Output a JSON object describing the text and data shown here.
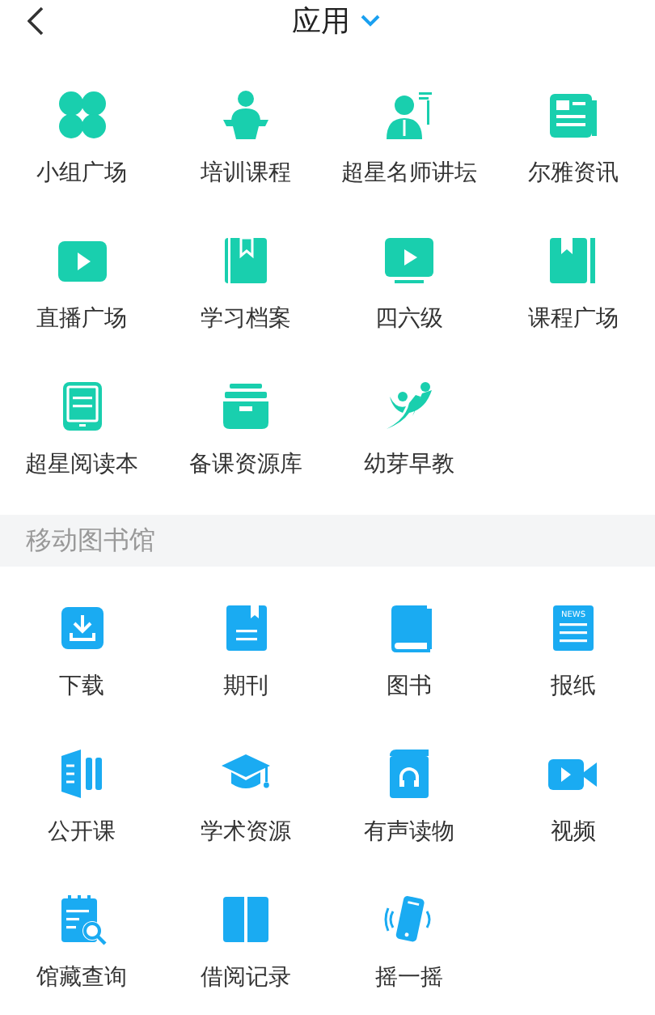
{
  "header": {
    "title": "应用"
  },
  "sections": [
    {
      "items": [
        {
          "label": "小组广场"
        },
        {
          "label": "培训课程"
        },
        {
          "label": "超星名师讲坛"
        },
        {
          "label": "尔雅资讯"
        },
        {
          "label": "直播广场"
        },
        {
          "label": "学习档案"
        },
        {
          "label": "四六级"
        },
        {
          "label": "课程广场"
        },
        {
          "label": "超星阅读本"
        },
        {
          "label": "备课资源库"
        },
        {
          "label": "幼芽早教"
        }
      ]
    },
    {
      "title": "移动图书馆",
      "items": [
        {
          "label": "下载"
        },
        {
          "label": "期刊"
        },
        {
          "label": "图书"
        },
        {
          "label": "报纸",
          "icon_text": "NEWS"
        },
        {
          "label": "公开课"
        },
        {
          "label": "学术资源"
        },
        {
          "label": "有声读物"
        },
        {
          "label": "视频"
        },
        {
          "label": "馆藏查询"
        },
        {
          "label": "借阅记录"
        },
        {
          "label": "摇一摇"
        }
      ]
    }
  ]
}
